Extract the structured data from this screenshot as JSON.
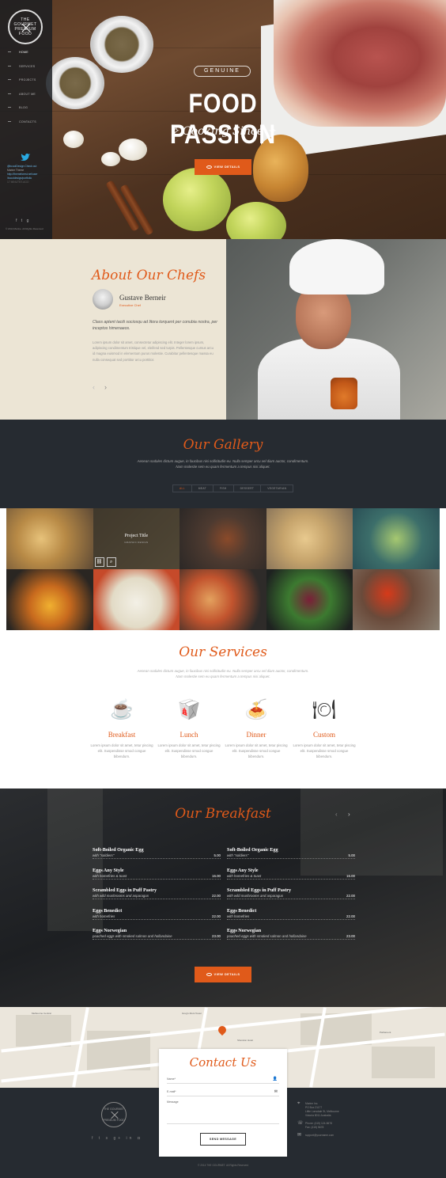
{
  "brand": {
    "logo_top": "THE GOURMET",
    "logo_bottom": "PREMIUM FOOD"
  },
  "nav": {
    "items": [
      "HOME",
      "SERVICES",
      "PROJECTS",
      "ABOUT ME",
      "BLOG",
      "CONTACTS"
    ]
  },
  "twitter": {
    "line1": "@bcoolDesign Check out",
    "line2": "Marine Theme",
    "line3": "http://themeforest.net/user",
    "line4": "/bcooldesign/portfolio",
    "time": "17 MINUTES AGO"
  },
  "sidebar": {
    "copyright": "© 2014 Marine. All Rights Reserved"
  },
  "hero": {
    "badge": "GENUINE",
    "title": "FOOD PASSION",
    "subtitle": "Cooking Since",
    "button": "VIEW DETAILS"
  },
  "about": {
    "title_accent": "About",
    "title_rest": " Our Chefs",
    "chef_name": "Gustave Berneir",
    "chef_role": "Executive Chef",
    "quote": "Class aptent taciti sociosqu ad litora torquent per conubia nostra, per inceptos himenaeos.",
    "body": "Lorem ipsum dolor sit amet, consectetur adipiscing elit. Integer lorem ipsum, adipiscing condimentum tristique vel, eleifend sed turpis. Pellentesque cursus arcu id magna euismod in elementum purus molestie. Curabitur pellentesque massa eu nulla consequat sed porttitor arcu porttitor."
  },
  "gallery": {
    "title_accent": "Our",
    "title_rest": " Gallery",
    "text1": "Aenean sodales dictum augue, in faucibus nisi sollicitudin eu. Nulla semper arcu vel diam auctor, condimentum.",
    "text2": "Nam molestie sem eu quam fermentum a tempus nisi aliquet.",
    "filters": [
      "ALL",
      "MEAT",
      "FISH",
      "DESSERT",
      "VEGETARIAN"
    ],
    "overlay_title": "Project Title",
    "overlay_category": "GRAPHIC DESIGN"
  },
  "services": {
    "title_accent": "Our",
    "title_rest": " Services",
    "text1": "Aenean sodales dictum augue, in faucibus nisi sollicitudin eu. Nulla semper arcu vel diam auctor, condimentum.",
    "text2": "Nam molestie sem eu quam fermentum a tempus nisi aliquet.",
    "items": [
      {
        "name": "Breakfast",
        "desc": "Lorem ipsum dolor sit amet, tetur piscing elit. Suspendisse smod congue bibendum.",
        "icon": "coffee-cup-icon"
      },
      {
        "name": "Lunch",
        "desc": "Lorem ipsum dolor sit amet, tetur piscing elit. Suspendisse smod congue bibendum.",
        "icon": "takeout-box-icon"
      },
      {
        "name": "Dinner",
        "desc": "Lorem ipsum dolor sit amet, tetur piscing elit. Suspendisse smod congue bibendum.",
        "icon": "spaghetti-plate-icon"
      },
      {
        "name": "Custom",
        "desc": "Lorem ipsum dolor sit amet, tetur piscing elit. Suspendisse smod congue bibendum.",
        "icon": "plate-cutlery-icon"
      }
    ]
  },
  "breakfast": {
    "title_accent": "Our",
    "title_rest": " Breakfast",
    "left": [
      {
        "name": "Soft-Boiled Organic Egg",
        "desc": "with \"soldiers\"",
        "price": "5.00"
      },
      {
        "name": "Eggs Any Style",
        "desc": "with homefries & toast",
        "price": "16.00"
      },
      {
        "name": "Scrambled Eggs in Puff Pastry",
        "desc": "with wild mushrooms and asparagus",
        "price": "22.00"
      },
      {
        "name": "Eggs Benedict",
        "desc": "with homefries",
        "price": "22.00"
      },
      {
        "name": "Eggs Norwegian",
        "desc": "poached eggs with smoked salmon and hollandaise",
        "price": "23.00"
      }
    ],
    "right": [
      {
        "name": "Soft-Boiled Organic Egg",
        "desc": "with \"soldiers\"",
        "price": "5.00"
      },
      {
        "name": "Eggs Any Style",
        "desc": "with homefries & toast",
        "price": "16.00"
      },
      {
        "name": "Scrambled Eggs in Puff Pastry",
        "desc": "with wild mushrooms and asparagus",
        "price": "22.00"
      },
      {
        "name": "Eggs Benedict",
        "desc": "with homefries",
        "price": "22.00"
      },
      {
        "name": "Eggs Norwegian",
        "desc": "poached eggs with smoked salmon and hollandaise",
        "price": "23.00"
      }
    ],
    "button": "VIEW DETAILS"
  },
  "contact": {
    "title_accent": "Contact",
    "title_rest": " Us",
    "name_placeholder": "Name*",
    "email_placeholder": "E-mail*",
    "message_placeholder": "Message",
    "send": "SEND MESSAGE"
  },
  "footer": {
    "logo_top": "THE GOURMET",
    "logo_bottom": "PREMIUM FOOD",
    "address": [
      "Marine Inc.",
      "PO Box 21177",
      "Little Lonsdale St, Melbourne",
      "Victoria 8011 Australia"
    ],
    "phone": "Phone: (415) 124-5678",
    "fax": "Fax: (415) 5678",
    "email": "support@yourname.com",
    "copyright": "© 2014 THE GOURMET. All Rights Reserved"
  },
  "map": {
    "labels": [
      "Greg's Mont Tower",
      "Sheraton Hotel",
      "Melbourne Central",
      "Parliament"
    ]
  },
  "colors": {
    "accent": "#e05a1a",
    "dark": "#262b31",
    "beige": "#ece5d5"
  }
}
